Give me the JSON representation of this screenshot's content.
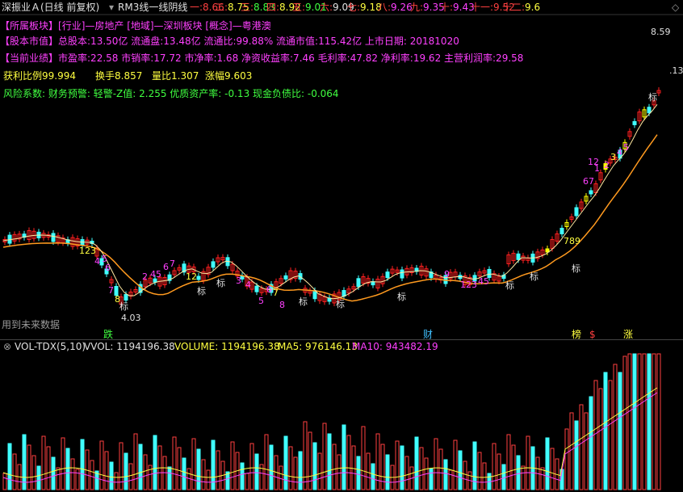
{
  "title": {
    "stock": "深振业Ａ(日线 前复权)",
    "formula": "RM3线一线阴线",
    "levels": [
      {
        "label": "一:",
        "value": "8.66",
        "color": "#ff4040"
      },
      {
        "label": "二:",
        "value": "8.75",
        "color": "#ffff40"
      },
      {
        "label": "三:",
        "value": "8.83",
        "color": "#40ff40"
      },
      {
        "label": "四:",
        "value": "8.92",
        "color": "#ffff40"
      },
      {
        "label": "五:",
        "value": "9.01",
        "color": "#40ff40"
      },
      {
        "label": "六:",
        "value": "9.09",
        "color": "#e0e0e0"
      },
      {
        "label": "七:",
        "value": "9.18",
        "color": "#ffff40"
      },
      {
        "label": "八:",
        "value": "9.26",
        "color": "#ff40ff"
      },
      {
        "label": "九:",
        "value": "9.35",
        "color": "#ff40ff"
      },
      {
        "label": "十:",
        "value": "9.43",
        "color": "#ff40ff"
      },
      {
        "label": "十一:",
        "value": "9.52",
        "color": "#ff4040"
      },
      {
        "label": "十二:",
        "value": "9.6",
        "color": "#ffff40"
      }
    ],
    "caret_icon": "diamond-icon"
  },
  "info": {
    "line1_tag": "【所属板块】",
    "line1_text": "[行业]—房地产 [地域]—深圳板块 [概念]—粤港澳",
    "line2_tag": "【股本市值】",
    "line2_text": "总股本:13.50亿 流通盘:13.48亿 流通比:99.88% 流通市值:115.42亿 上市日期: 20181020",
    "line3_tag": "【当前业绩】",
    "line3_text": "市盈率:22.58 市销率:17.72 市净率:1.68 净资收益率:7.46 毛利率:47.82 净利率:19.62 主营利润率:29.58",
    "line4_a": "获利比例99.994",
    "line4_b": "换手8.857",
    "line4_c": "量比1.307",
    "line4_d": "涨幅9.603",
    "line5": "风险系数: 财务预警: 轻警-Z值: 2.255 优质资产率: -0.13 现金负债比: -0.064"
  },
  "price_chart": {
    "high_label": "8.59",
    "low_label": "4.03",
    "right_label": ".13",
    "future_note": "用到未来数据",
    "markers": {
      "die": "跌",
      "cai": "财",
      "bang": "榜",
      "zhang": "涨",
      "dollar": "$",
      "biao": "标"
    },
    "numbers": [
      "123",
      "4",
      "5",
      "6",
      "7",
      "8",
      "2",
      "45",
      "6",
      "7",
      "12",
      "3",
      "4",
      "5",
      "6",
      "7",
      "8",
      "9",
      "123",
      "45",
      "789",
      "12",
      "67",
      "1",
      "2",
      "3",
      "4",
      "5"
    ],
    "colors": {
      "ma_orange": "#ff9a1f",
      "ma_cyan": "#40e0ff",
      "up": "#ff2020",
      "down": "#40ffff",
      "signal": "#ffff00"
    }
  },
  "volume": {
    "indicator": "VOL-TDX(5,10)",
    "vvol": "VVOL: 1194196.38",
    "volume": "VOLUME: 1194196.38",
    "ma5": "MA5: 976146.13",
    "ma10": "MA10: 943482.19"
  }
}
